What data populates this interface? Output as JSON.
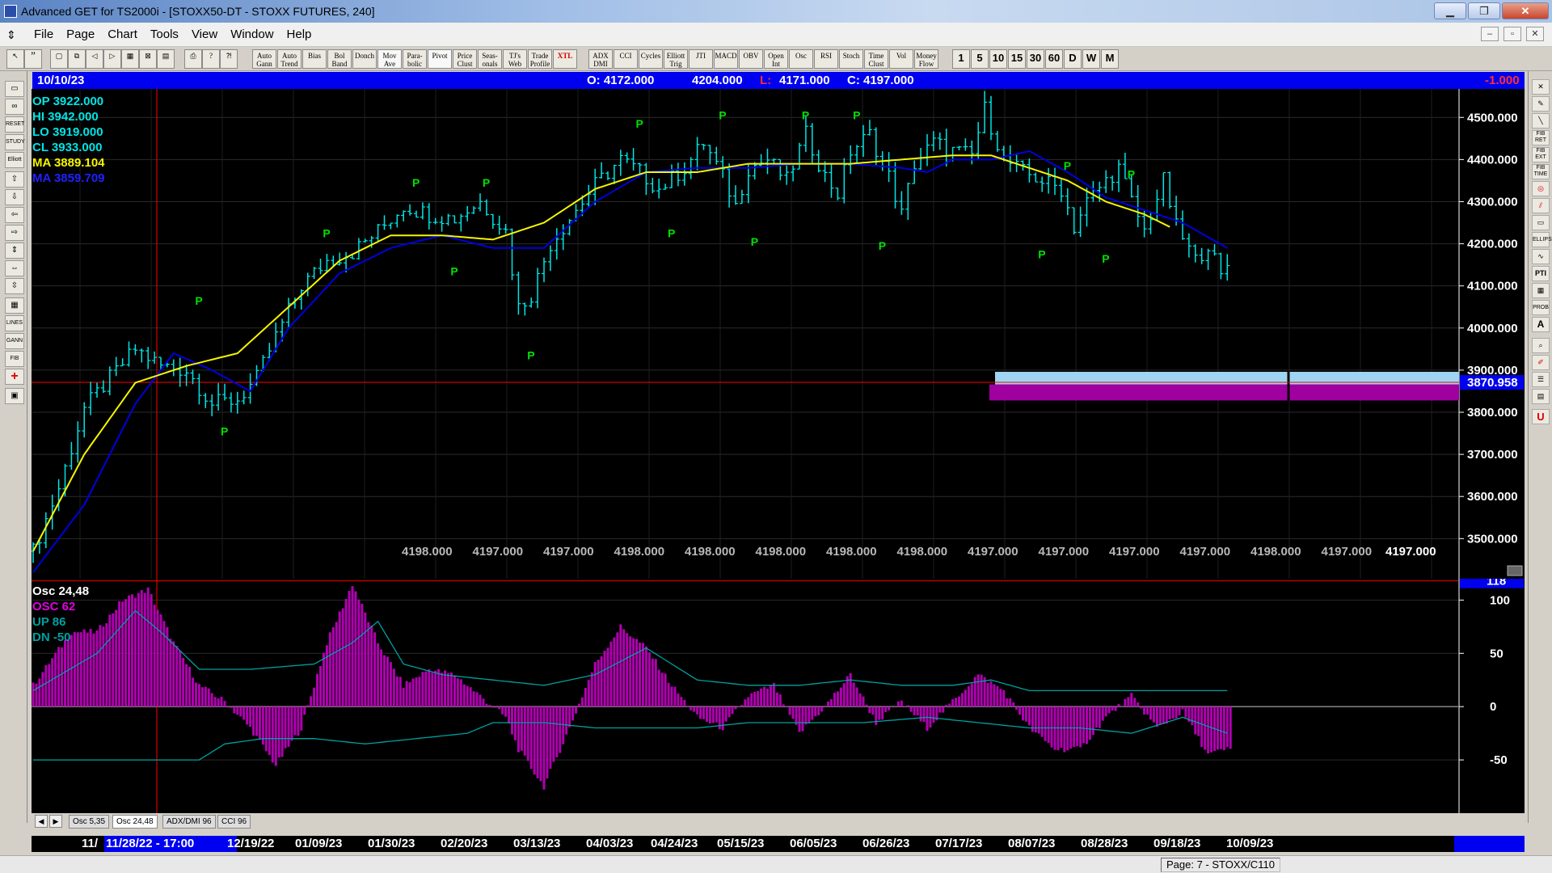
{
  "window": {
    "title": "Advanced GET for TS2000i - [STOXX50-DT - STOXX FUTURES, 240]",
    "minimize": "▁",
    "maximize": "❐",
    "close": "✕"
  },
  "menu": {
    "items": [
      "File",
      "Page",
      "Chart",
      "Tools",
      "View",
      "Window",
      "Help"
    ],
    "mdi_buttons": [
      "–",
      "▫",
      "✕"
    ]
  },
  "toolbar": {
    "left_icons": [
      "cursor-icon",
      "double-quote-icon",
      "new-page-icon",
      "copy-page-icon",
      "arrow-left-page-icon",
      "arrow-right-page-icon",
      "grid-icon",
      "crosshair-box-icon",
      "layers-icon",
      "print-icon",
      "help-icon",
      "help-pointer-icon"
    ],
    "study_buttons": [
      "Auto Gann",
      "Auto Trend",
      "Bias",
      "Bol Band",
      "Donch",
      "Mov Ave",
      "Para- bolic",
      "Pivot",
      "Price Clust",
      "Seas- onals",
      "TJ's Web",
      "Trade Profile",
      "XTL",
      "ADX DMI",
      "CCI",
      "Cycles",
      "Elliott Trig",
      "JTI",
      "MACD",
      "OBV",
      "Open Int",
      "Osc",
      "RSI",
      "Stoch",
      "Time Clust",
      "Vol",
      "Money Flow"
    ],
    "intervals": [
      "1",
      "5",
      "10",
      "15",
      "30",
      "60",
      "D",
      "W",
      "M"
    ]
  },
  "left_tools": [
    "open-folder-icon",
    "binoculars-icon",
    "RESET",
    "STUDY",
    "Elliott",
    "arrow-up-icon",
    "arrow-down-icon",
    "arrow-left-icon",
    "arrow-right-icon",
    "expand-vertical-icon",
    "expand-horizontal-icon",
    "compress-vertical-icon",
    "spreadsheet-icon",
    "LINES",
    "GANN",
    "FIB",
    "+",
    "chart-window-icon"
  ],
  "right_tools": [
    "✕",
    "pencil-icon",
    "line-icon",
    "FIB RET",
    "FIB EXT",
    "FIB TIME",
    "target-icon",
    "channel-icon",
    "rectangle-icon",
    "ELLIPS",
    "wave-icon",
    "PTI",
    "table-icon",
    "PROB",
    "A",
    "zoom-icon",
    "brush-icon",
    "list-icon",
    "stack-icon",
    "U"
  ],
  "info_bar": {
    "date": "10/10/23",
    "open": "O: 4172.000",
    "high": "4204.000",
    "low_label": "L:",
    "low": "4171.000",
    "close": "C: 4197.000",
    "change": "-1.000"
  },
  "price_legend": {
    "op": "OP  3922.000",
    "hi": "HI   3942.000",
    "lo": "LO  3919.000",
    "cl": "CL  3933.000",
    "ma1": "MA  3889.104",
    "ma2": "MA  3859.709"
  },
  "price_axis": {
    "labels": [
      "4500.000",
      "4400.000",
      "4300.000",
      "4200.000",
      "4100.000",
      "4000.000",
      "3900.000",
      "3800.000",
      "3700.000",
      "3600.000",
      "3500.000"
    ],
    "crosshair_value": "3870.958",
    "last_value": "4197.000"
  },
  "bottom_values": [
    "4198.000",
    "4197.000",
    "4197.000",
    "4198.000",
    "4198.000",
    "4198.000",
    "4198.000",
    "4198.000",
    "4197.000",
    "4197.000",
    "4197.000",
    "4197.000",
    "4198.000",
    "4197.000"
  ],
  "pivot_label": "P",
  "osc_legend": {
    "title": "Osc 24,48",
    "osc": "OSC 62",
    "up": "UP   86",
    "dn": "DN   -50"
  },
  "osc_axis": {
    "labels": [
      "100",
      "50",
      "0",
      "-50"
    ],
    "crosshair_value": "118"
  },
  "tabs": [
    "Osc 5,35",
    "Osc 24,48",
    "ADX/DMI 96",
    "CCI 96"
  ],
  "dates": [
    "11/",
    "11/28/22 - 17:00",
    "12/19/22",
    "01/09/23",
    "01/30/23",
    "02/20/23",
    "03/13/23",
    "04/03/23",
    "04/24/23",
    "05/15/23",
    "06/05/23",
    "06/26/23",
    "07/17/23",
    "08/07/23",
    "08/28/23",
    "09/18/23",
    "10/09/23"
  ],
  "status": {
    "page": "Page: 7 - STOXX/C110"
  },
  "chart_data": {
    "type": "line",
    "ylim": [
      3420,
      4560
    ],
    "price_series_anchors": [
      [
        0,
        3470
      ],
      [
        4,
        3620
      ],
      [
        8,
        3810
      ],
      [
        12,
        3880
      ],
      [
        16,
        3950
      ],
      [
        20,
        3910
      ],
      [
        24,
        3900
      ],
      [
        28,
        3820
      ],
      [
        32,
        3830
      ],
      [
        35,
        3880
      ],
      [
        38,
        3980
      ],
      [
        42,
        4100
      ],
      [
        46,
        4160
      ],
      [
        50,
        4180
      ],
      [
        54,
        4230
      ],
      [
        58,
        4290
      ],
      [
        62,
        4270
      ],
      [
        66,
        4260
      ],
      [
        70,
        4300
      ],
      [
        74,
        4230
      ],
      [
        76,
        4050
      ],
      [
        78,
        4080
      ],
      [
        81,
        4200
      ],
      [
        84,
        4260
      ],
      [
        88,
        4340
      ],
      [
        92,
        4400
      ],
      [
        95,
        4370
      ],
      [
        98,
        4330
      ],
      [
        102,
        4380
      ],
      [
        105,
        4440
      ],
      [
        108,
        4360
      ],
      [
        110,
        4290
      ],
      [
        112,
        4380
      ],
      [
        115,
        4400
      ],
      [
        118,
        4350
      ],
      [
        121,
        4460
      ],
      [
        124,
        4360
      ],
      [
        126,
        4320
      ],
      [
        128,
        4420
      ],
      [
        131,
        4460
      ],
      [
        134,
        4360
      ],
      [
        136,
        4270
      ],
      [
        138,
        4390
      ],
      [
        141,
        4440
      ],
      [
        144,
        4420
      ],
      [
        147,
        4410
      ],
      [
        149,
        4520
      ],
      [
        152,
        4400
      ],
      [
        155,
        4370
      ],
      [
        158,
        4350
      ],
      [
        161,
        4330
      ],
      [
        163,
        4240
      ],
      [
        165,
        4300
      ],
      [
        168,
        4350
      ],
      [
        170,
        4380
      ],
      [
        172,
        4300
      ],
      [
        174,
        4230
      ],
      [
        177,
        4350
      ],
      [
        179,
        4240
      ],
      [
        182,
        4160
      ],
      [
        184,
        4200
      ],
      [
        186,
        4120
      ],
      [
        187,
        4150
      ]
    ],
    "moving_average_yellow_anchors": [
      [
        0,
        3470
      ],
      [
        8,
        3700
      ],
      [
        16,
        3870
      ],
      [
        24,
        3910
      ],
      [
        32,
        3940
      ],
      [
        40,
        4050
      ],
      [
        48,
        4160
      ],
      [
        56,
        4220
      ],
      [
        64,
        4220
      ],
      [
        72,
        4210
      ],
      [
        80,
        4250
      ],
      [
        88,
        4330
      ],
      [
        96,
        4370
      ],
      [
        104,
        4370
      ],
      [
        112,
        4390
      ],
      [
        120,
        4390
      ],
      [
        128,
        4390
      ],
      [
        136,
        4400
      ],
      [
        144,
        4410
      ],
      [
        150,
        4410
      ],
      [
        156,
        4380
      ],
      [
        162,
        4350
      ],
      [
        168,
        4300
      ],
      [
        174,
        4270
      ],
      [
        178,
        4240
      ]
    ],
    "moving_average_blue_anchors": [
      [
        0,
        3420
      ],
      [
        8,
        3580
      ],
      [
        16,
        3820
      ],
      [
        22,
        3940
      ],
      [
        28,
        3900
      ],
      [
        34,
        3850
      ],
      [
        40,
        4000
      ],
      [
        48,
        4130
      ],
      [
        56,
        4190
      ],
      [
        64,
        4220
      ],
      [
        72,
        4190
      ],
      [
        80,
        4190
      ],
      [
        88,
        4300
      ],
      [
        96,
        4370
      ],
      [
        104,
        4380
      ],
      [
        112,
        4380
      ],
      [
        120,
        4390
      ],
      [
        128,
        4390
      ],
      [
        136,
        4380
      ],
      [
        140,
        4370
      ],
      [
        144,
        4400
      ],
      [
        150,
        4400
      ],
      [
        156,
        4420
      ],
      [
        162,
        4370
      ],
      [
        168,
        4310
      ],
      [
        174,
        4280
      ],
      [
        180,
        4250
      ],
      [
        187,
        4190
      ]
    ],
    "pivots": [
      {
        "i": 26,
        "v": 4040,
        "type": "high"
      },
      {
        "i": 30,
        "v": 3780,
        "type": "low"
      },
      {
        "i": 46,
        "v": 4200,
        "type": "high"
      },
      {
        "i": 60,
        "v": 4320,
        "type": "high"
      },
      {
        "i": 66,
        "v": 4160,
        "type": "low"
      },
      {
        "i": 71,
        "v": 4320,
        "type": "high"
      },
      {
        "i": 78,
        "v": 3960,
        "type": "low"
      },
      {
        "i": 95,
        "v": 4460,
        "type": "high"
      },
      {
        "i": 100,
        "v": 4250,
        "type": "low"
      },
      {
        "i": 108,
        "v": 4480,
        "type": "high"
      },
      {
        "i": 113,
        "v": 4230,
        "type": "low"
      },
      {
        "i": 121,
        "v": 4480,
        "type": "high"
      },
      {
        "i": 129,
        "v": 4480,
        "type": "high"
      },
      {
        "i": 133,
        "v": 4220,
        "type": "low"
      },
      {
        "i": 158,
        "v": 4200,
        "type": "low"
      },
      {
        "i": 162,
        "v": 4360,
        "type": "high"
      },
      {
        "i": 168,
        "v": 4190,
        "type": "low"
      },
      {
        "i": 172,
        "v": 4340,
        "type": "high"
      }
    ],
    "oscillator": {
      "ylim": [
        -100,
        120
      ],
      "osc_anchors": [
        [
          0,
          20
        ],
        [
          6,
          70
        ],
        [
          10,
          70
        ],
        [
          14,
          100
        ],
        [
          18,
          110
        ],
        [
          22,
          60
        ],
        [
          26,
          20
        ],
        [
          30,
          5
        ],
        [
          34,
          -20
        ],
        [
          38,
          -55
        ],
        [
          42,
          -20
        ],
        [
          46,
          60
        ],
        [
          50,
          115
        ],
        [
          54,
          60
        ],
        [
          58,
          20
        ],
        [
          62,
          35
        ],
        [
          66,
          30
        ],
        [
          70,
          10
        ],
        [
          74,
          -10
        ],
        [
          76,
          -40
        ],
        [
          80,
          -75
        ],
        [
          84,
          -20
        ],
        [
          88,
          40
        ],
        [
          92,
          75
        ],
        [
          96,
          55
        ],
        [
          100,
          20
        ],
        [
          104,
          -10
        ],
        [
          108,
          -20
        ],
        [
          112,
          10
        ],
        [
          116,
          20
        ],
        [
          120,
          -25
        ],
        [
          124,
          0
        ],
        [
          128,
          30
        ],
        [
          132,
          -15
        ],
        [
          136,
          5
        ],
        [
          140,
          -20
        ],
        [
          144,
          5
        ],
        [
          148,
          30
        ],
        [
          152,
          15
        ],
        [
          156,
          -20
        ],
        [
          160,
          -40
        ],
        [
          164,
          -40
        ],
        [
          168,
          -10
        ],
        [
          172,
          10
        ],
        [
          176,
          -20
        ],
        [
          180,
          -5
        ],
        [
          184,
          -45
        ],
        [
          187,
          -40
        ]
      ],
      "upper_band_anchors": [
        [
          0,
          15
        ],
        [
          10,
          50
        ],
        [
          16,
          90
        ],
        [
          20,
          70
        ],
        [
          26,
          35
        ],
        [
          34,
          35
        ],
        [
          44,
          40
        ],
        [
          50,
          60
        ],
        [
          54,
          80
        ],
        [
          58,
          40
        ],
        [
          64,
          30
        ],
        [
          72,
          25
        ],
        [
          80,
          20
        ],
        [
          88,
          30
        ],
        [
          96,
          55
        ],
        [
          104,
          25
        ],
        [
          112,
          20
        ],
        [
          120,
          20
        ],
        [
          128,
          25
        ],
        [
          136,
          20
        ],
        [
          144,
          20
        ],
        [
          150,
          25
        ],
        [
          156,
          15
        ],
        [
          168,
          15
        ],
        [
          187,
          15
        ]
      ],
      "lower_band_anchors": [
        [
          0,
          -50
        ],
        [
          26,
          -50
        ],
        [
          30,
          -35
        ],
        [
          36,
          -30
        ],
        [
          44,
          -30
        ],
        [
          52,
          -35
        ],
        [
          60,
          -30
        ],
        [
          68,
          -25
        ],
        [
          72,
          -15
        ],
        [
          80,
          -15
        ],
        [
          88,
          -20
        ],
        [
          96,
          -20
        ],
        [
          104,
          -20
        ],
        [
          112,
          -15
        ],
        [
          120,
          -15
        ],
        [
          130,
          -15
        ],
        [
          140,
          -10
        ],
        [
          148,
          -15
        ],
        [
          156,
          -20
        ],
        [
          164,
          -20
        ],
        [
          172,
          -25
        ],
        [
          180,
          -10
        ],
        [
          187,
          -25
        ]
      ]
    },
    "colors": {
      "price": "#00e5e5",
      "ma_yellow": "#f5f500",
      "ma_blue": "#0000e0",
      "pivot": "#00e000",
      "osc": "#b000b0",
      "band": "#00a0a0",
      "crosshair": "#ff0000",
      "zone_top": "#9fd4f2",
      "zone_bottom": "#a000a0"
    }
  }
}
